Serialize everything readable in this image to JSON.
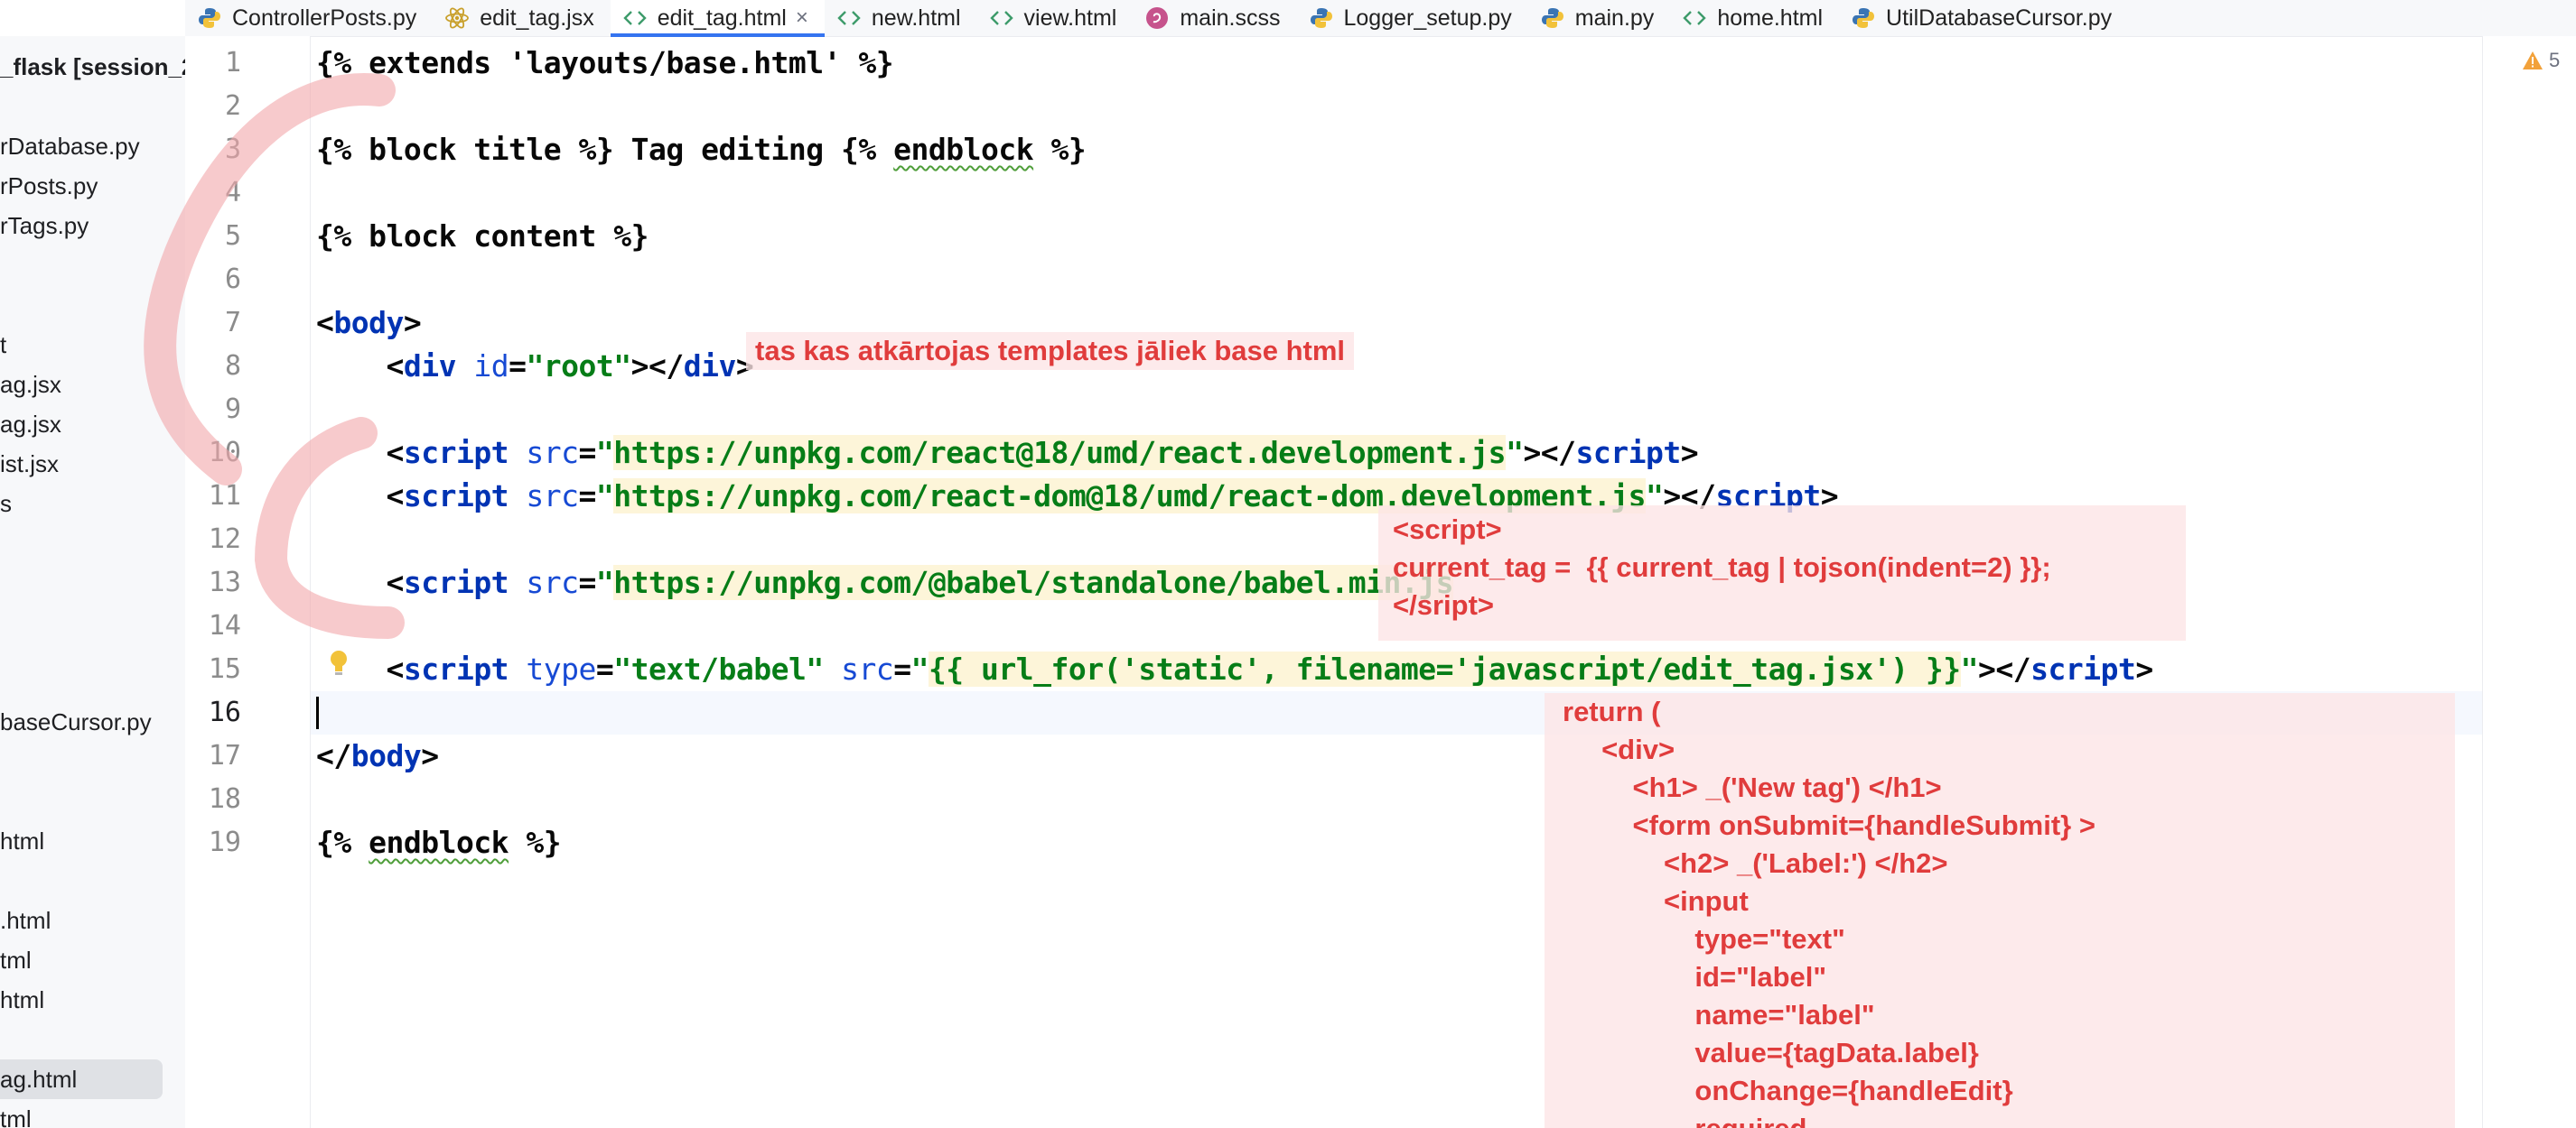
{
  "tabs": [
    {
      "label": "ControllerPosts.py",
      "icon": "python-icon"
    },
    {
      "label": "edit_tag.jsx",
      "icon": "react-icon"
    },
    {
      "label": "edit_tag.html",
      "icon": "html-icon",
      "active": true
    },
    {
      "label": "new.html",
      "icon": "html-icon"
    },
    {
      "label": "view.html",
      "icon": "html-icon"
    },
    {
      "label": "main.scss",
      "icon": "sass-icon"
    },
    {
      "label": "Logger_setup.py",
      "icon": "python-icon"
    },
    {
      "label": "main.py",
      "icon": "python-icon"
    },
    {
      "label": "home.html",
      "icon": "html-icon"
    },
    {
      "label": "UtilDatabaseCursor.py",
      "icon": "python-icon"
    }
  ],
  "tab_close_glyph": "×",
  "sidebar": {
    "project": "_flask",
    "branch": "[session_2",
    "items": [
      "rDatabase.py",
      "rPosts.py",
      "rTags.py",
      "t",
      "ag.jsx",
      "ag.jsx",
      "ist.jsx",
      "s",
      "baseCursor.py",
      "html",
      ".html",
      "tml",
      "html",
      "ag.html",
      "tml"
    ]
  },
  "gutter": {
    "line_numbers": [
      "1",
      "2",
      "3",
      "4",
      "5",
      "6",
      "7",
      "8",
      "9",
      "10",
      "11",
      "12",
      "13",
      "14",
      "15",
      "16",
      "17",
      "18",
      "19"
    ],
    "current_line": "16"
  },
  "code": {
    "l1": "{% extends 'layouts/base.html' %}",
    "l3a": "{% block title %} Tag editing {% ",
    "l3b": "endblock",
    "l3c": " %}",
    "l5": "{% block content %}",
    "l7a": "<",
    "l7b": "body",
    "l7c": ">",
    "l8a": "    <",
    "l8b": "div",
    "l8c": " id",
    "l8d": "=",
    "l8e": "\"root\"",
    "l8f": "></",
    "l8g": "div",
    "l8h": ">",
    "l10a": "    <",
    "l10b": "script",
    "l10c": " src",
    "l10d": "=",
    "l10e": "\"",
    "l10f": "https://unpkg.com/react@18/umd/react.development.js",
    "l10g": "\"",
    "l10h": "></",
    "l10i": "script",
    "l10j": ">",
    "l11a": "    <",
    "l11b": "script",
    "l11c": " src",
    "l11d": "=",
    "l11e": "\"",
    "l11f": "https://unpkg.com/react-dom@18/umd/react-dom.development.js",
    "l11g": "\"",
    "l11h": "></",
    "l11i": "script",
    "l11j": ">",
    "l13a": "    <",
    "l13b": "script",
    "l13c": " src",
    "l13d": "=",
    "l13e": "\"",
    "l13f": "https://unpkg.com/@babel/standalone/babel.min.js",
    "l15a": "    <",
    "l15b": "script",
    "l15c": " type",
    "l15d": "=",
    "l15e": "\"text/babel\"",
    "l15f": " src",
    "l15g": "=",
    "l15h": "\"",
    "l15i": "{{ url_for('static', filename='javascript/edit_tag.jsx') }}",
    "l15j": "\"",
    "l15k": "></",
    "l15l": "script",
    "l15m": ">",
    "l17a": "</",
    "l17b": "body",
    "l17c": ">",
    "l19a": "{% ",
    "l19b": "endblock",
    "l19c": " %}"
  },
  "warnings": {
    "count": "5"
  },
  "notes": {
    "note1": "tas kas atkārtojas templates jāliek base html",
    "note2": "<script>\ncurrent_tag =  {{ current_tag | tojson(indent=2) }};\n</sript>",
    "note3": "return (\n     <div>\n         <h1> _('New tag') </h1>\n         <form onSubmit={handleSubmit} >\n             <h2> _('Label:') </h2>\n             <input\n                 type=\"text\"\n                 id=\"label\"\n                 name=\"label\"\n                 value={tagData.label}\n                 onChange={handleEdit}\n                 required"
  },
  "colors": {
    "accent": "#3574f0",
    "tag": "#0033b3",
    "attr": "#174ad4",
    "string": "#067d17",
    "annotation": "#e03c3c"
  }
}
